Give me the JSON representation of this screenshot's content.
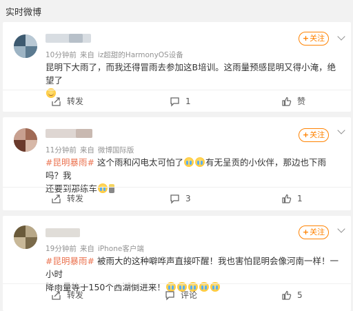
{
  "header": {
    "title": "实时微博"
  },
  "posts": [
    {
      "meta_time": "10分钟前",
      "meta_from": "来自",
      "meta_device": "iz超甜的HarmonyOS设备",
      "follow_label": "关注",
      "text_parts": [
        "昆明下大雨了，而我还得冒雨去参加这B培训。这雨量预感昆明又得小淹，绝望了"
      ],
      "actions": {
        "repost": "转发",
        "comment": "1",
        "like": "赞"
      }
    },
    {
      "meta_time": "11分钟前",
      "meta_from": "来自",
      "meta_device": "微博国际版",
      "follow_label": "关注",
      "tag": "#昆明暴雨#",
      "text_a": "这个雨和闪电太可怕了",
      "text_b": "有无呈贡的小伙伴，那边也下雨吗？我",
      "text_c": "还要到那练车",
      "actions": {
        "repost": "转发",
        "comment": "3",
        "like": "1"
      }
    },
    {
      "meta_time": "19分钟前",
      "meta_from": "来自",
      "meta_device": "iPhone客户端",
      "follow_label": "关注",
      "tag": "#昆明暴雨#",
      "text_a": "被雨大的这种噼哗声直接吓醒！我也害怕昆明会像河南一样！一小时",
      "text_b": "降雨量等于150个西湖倒进来！",
      "actions": {
        "repost": "转发",
        "comment": "评论",
        "like": "5"
      }
    }
  ],
  "colors": {
    "accent": "#ff8200",
    "tag": "#eb7350",
    "meta": "#939393",
    "page_bg": "#f2f2f2"
  },
  "icons": [
    "repost-icon",
    "comment-icon",
    "like-icon",
    "chevron-down-icon",
    "plus-icon"
  ]
}
